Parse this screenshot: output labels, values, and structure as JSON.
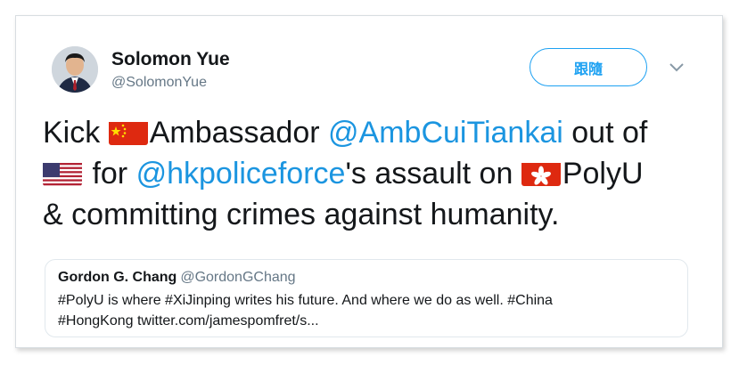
{
  "author": {
    "name": "Solomon Yue",
    "handle": "@SolomonYue"
  },
  "follow_button": {
    "label": "跟隨"
  },
  "icons": {
    "avatar": "avatar-photo",
    "menu": "chevron-down-icon",
    "flag_china": "china-flag-icon",
    "flag_us": "us-flag-icon",
    "flag_hk": "hong-kong-flag-icon"
  },
  "tweet": {
    "w1": "Kick ",
    "w2": "Ambassador ",
    "mention1": "@AmbCuiTiankai",
    "w3": " out of",
    "w4": " for ",
    "mention2": "@hkpoliceforce",
    "w5": "'s assault on ",
    "w6": "PolyU",
    "w7": "& committing crimes against humanity."
  },
  "quote": {
    "name": "Gordon G. Chang",
    "handle": "@GordonGChang",
    "line1": "#PolyU is where #XiJinping writes his future. And where we do as well. #China",
    "line2": "#HongKong twitter.com/jamespomfret/s..."
  },
  "colors": {
    "accent": "#1da1f2",
    "link": "#1b95e0",
    "text": "#14171a",
    "muted": "#657786"
  }
}
